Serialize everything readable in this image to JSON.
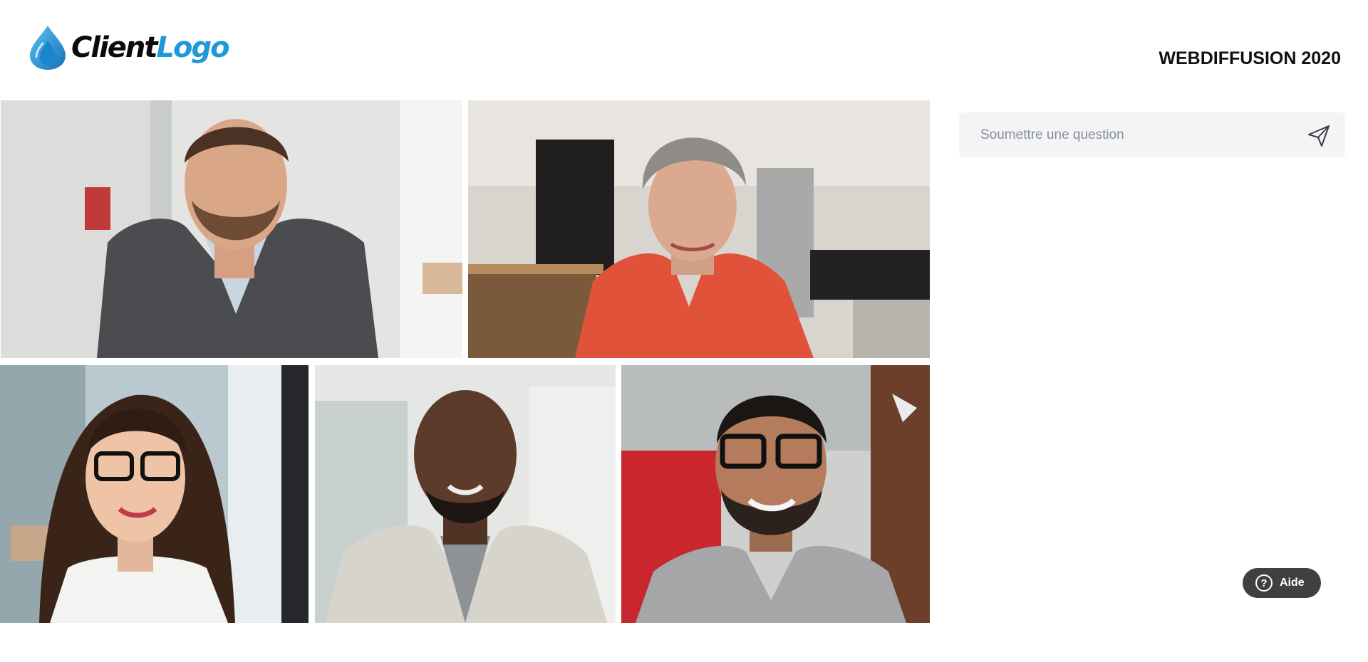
{
  "header": {
    "logo_text_part1": "Client",
    "logo_text_part2": "Logo",
    "event_title": "WEBDIFFUSION 2020"
  },
  "question": {
    "placeholder": "Soumettre une question",
    "value": "",
    "send_icon": "send-icon"
  },
  "help": {
    "icon_glyph": "?",
    "label": "Aide"
  },
  "participants": [
    {
      "icon": "participant-video-1"
    },
    {
      "icon": "participant-video-2"
    },
    {
      "icon": "participant-video-3"
    },
    {
      "icon": "participant-video-4"
    },
    {
      "icon": "participant-video-5"
    }
  ],
  "colors": {
    "brand_blue": "#1e98d8",
    "logo_dark": "#0b0b0b",
    "input_bg": "#f3f4f6",
    "help_bg": "#3e4042"
  }
}
